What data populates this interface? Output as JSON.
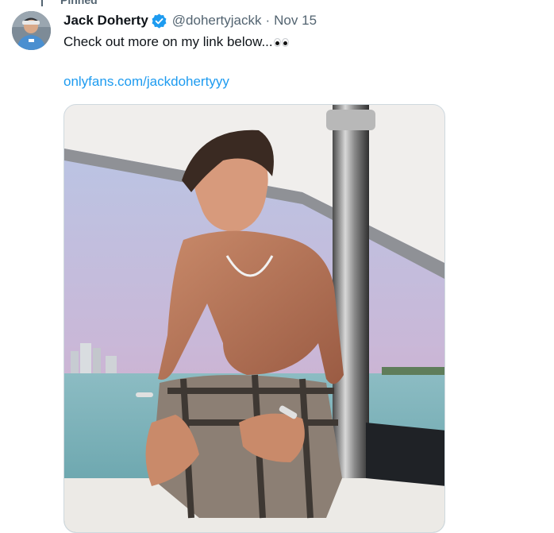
{
  "tweet": {
    "pinned_label": "Pinned",
    "author": {
      "display_name": "Jack Doherty",
      "handle": "@dohertyjackk",
      "verified": true
    },
    "separator": "·",
    "date": "Nov 15",
    "text": "Check out more on my link below...",
    "emoji": "eyes",
    "link": "onlyfans.com/jackdohertyyy",
    "media": {
      "description_icon": "photo"
    }
  },
  "colors": {
    "text": "#0f1419",
    "secondary": "#536471",
    "link": "#1d9bf0",
    "verified": "#1d9bf0"
  }
}
